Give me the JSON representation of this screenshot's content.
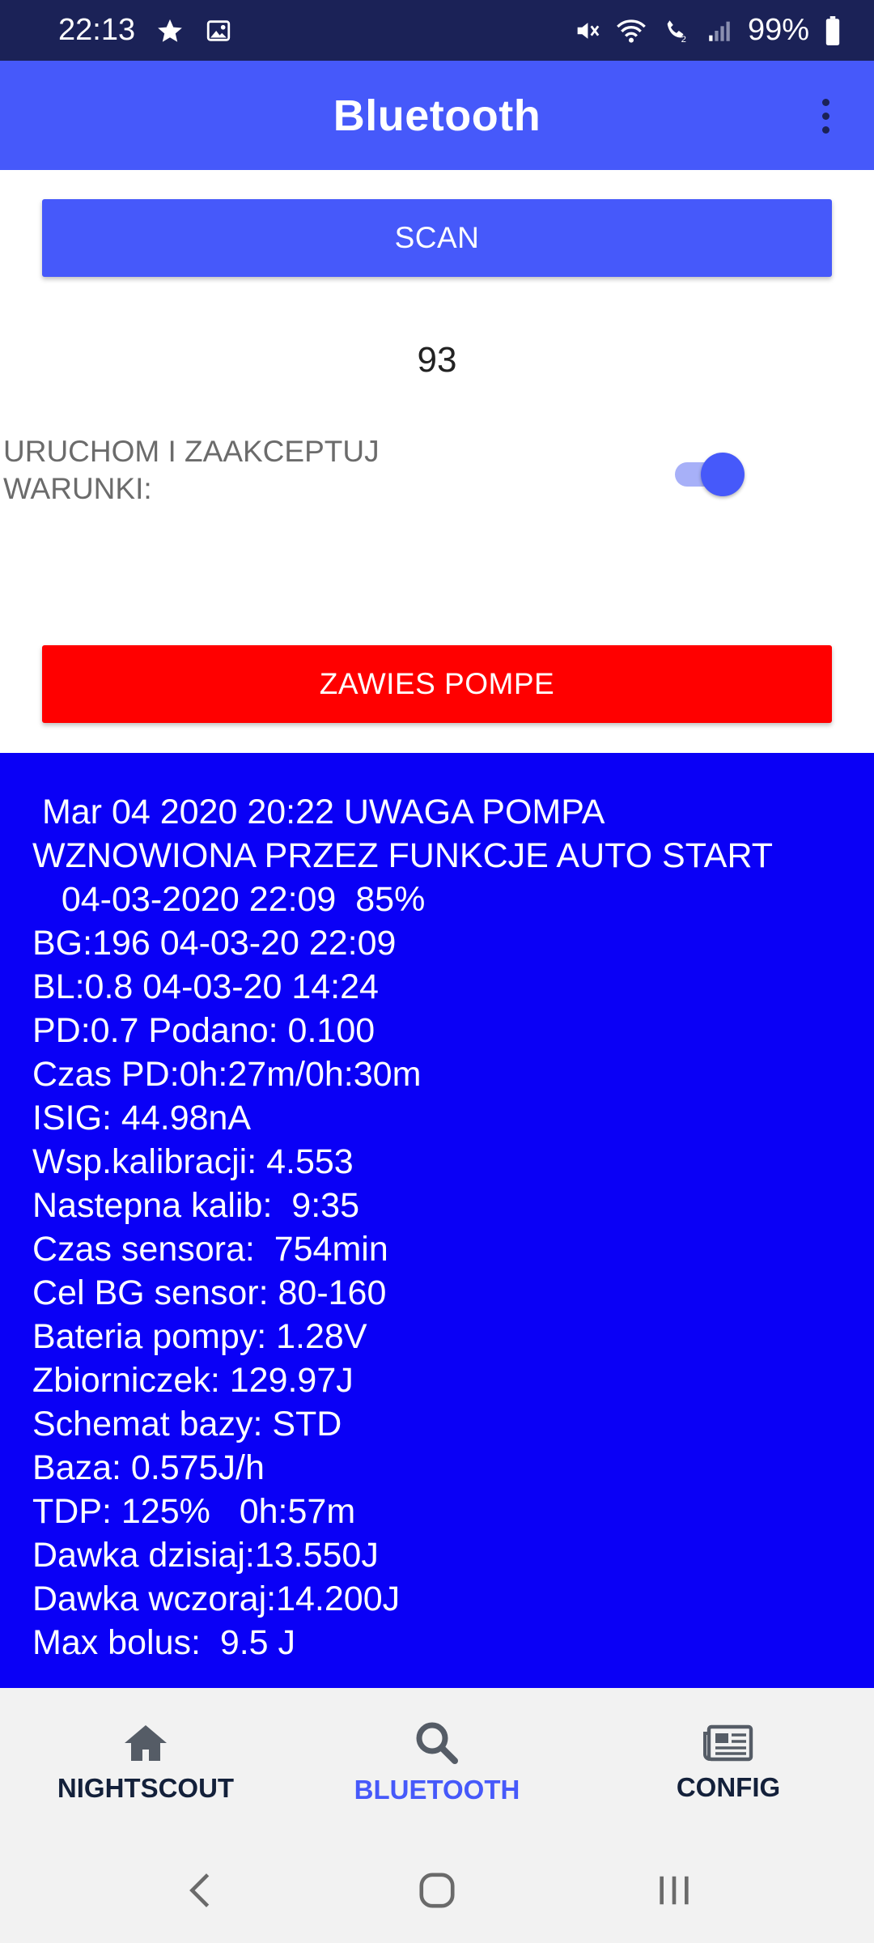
{
  "status_bar": {
    "time": "22:13",
    "battery": "99%",
    "icons_left": [
      "star-icon",
      "image-icon"
    ],
    "icons_right": [
      "mute-icon",
      "wifi-icon",
      "wifi-call-icon",
      "signal-icon",
      "battery-icon"
    ]
  },
  "app_bar": {
    "title": "Bluetooth",
    "menu_icon": "more-vert-icon",
    "color": "#4659fa"
  },
  "controls": {
    "scan_label": "SCAN",
    "counter_value": "93",
    "accept_label": "URUCHOM I ZAAKCEPTUJ WARUNKI:",
    "accept_toggle_on": true,
    "suspend_label": "ZAWIES POMPE",
    "suspend_color": "#ff0000"
  },
  "log": {
    "background": "#0a00f6",
    "lines": [
      " Mar 04 2020 20:22 UWAGA POMPA",
      "WZNOWIONA PRZEZ FUNKCJE AUTO START",
      "",
      "   04-03-2020 22:09  85%",
      "BG:196 04-03-20 22:09",
      "BL:0.8 04-03-20 14:24",
      "PD:0.7 Podano: 0.100",
      "Czas PD:0h:27m/0h:30m",
      "ISIG: 44.98nA",
      "Wsp.kalibracji: 4.553",
      "Nastepna kalib:  9:35",
      "Czas sensora:  754min",
      "Cel BG sensor: 80-160",
      "Bateria pompy: 1.28V",
      "Zbiorniczek: 129.97J",
      "Schemat bazy: STD",
      "Baza: 0.575J/h",
      "TDP: 125%   0h:57m",
      "Dawka dzisiaj:13.550J",
      "Dawka wczoraj:14.200J",
      "Max bolus:  9.5 J"
    ]
  },
  "bottom_nav": {
    "items": [
      {
        "label": "NIGHTSCOUT",
        "icon": "home-icon",
        "active": false
      },
      {
        "label": "BLUETOOTH",
        "icon": "search-icon",
        "active": true
      },
      {
        "label": "CONFIG",
        "icon": "newspaper-icon",
        "active": false
      }
    ]
  },
  "system_nav": {
    "buttons": [
      "back-icon",
      "home-circle-icon",
      "recents-icon"
    ]
  }
}
